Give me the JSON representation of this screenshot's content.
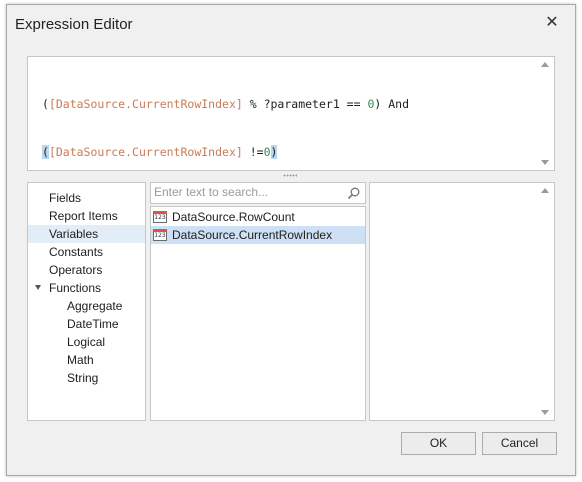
{
  "window": {
    "title": "Expression Editor",
    "close_glyph": "✕"
  },
  "expression": {
    "line1": [
      {
        "t": "(",
        "c": "plain"
      },
      {
        "t": "[DataSource.CurrentRowIndex]",
        "c": "field"
      },
      {
        "t": " % ?parameter1 == ",
        "c": "plain"
      },
      {
        "t": "0",
        "c": "num"
      },
      {
        "t": ") And",
        "c": "plain"
      }
    ],
    "line2": [
      {
        "t": "(",
        "c": "paren-hl"
      },
      {
        "t": "[DataSource.CurrentRowIndex]",
        "c": "field"
      },
      {
        "t": " !=",
        "c": "plain"
      },
      {
        "t": "0",
        "c": "num"
      },
      {
        "t": ")",
        "c": "paren-hl"
      }
    ]
  },
  "categories": [
    {
      "label": "Fields",
      "indent": 0
    },
    {
      "label": "Report Items",
      "indent": 0
    },
    {
      "label": "Variables",
      "indent": 0,
      "selected": true
    },
    {
      "label": "Constants",
      "indent": 0
    },
    {
      "label": "Operators",
      "indent": 0
    },
    {
      "label": "Functions",
      "indent": 0,
      "expanded": true
    },
    {
      "label": "Aggregate",
      "indent": 1
    },
    {
      "label": "DateTime",
      "indent": 1
    },
    {
      "label": "Logical",
      "indent": 1
    },
    {
      "label": "Math",
      "indent": 1
    },
    {
      "label": "String",
      "indent": 1
    }
  ],
  "search": {
    "placeholder": "Enter text to search..."
  },
  "items": [
    {
      "label": "DataSource.RowCount",
      "icon": "123",
      "selected": false
    },
    {
      "label": "DataSource.CurrentRowIndex",
      "icon": "123",
      "selected": true
    }
  ],
  "buttons": {
    "ok": "OK",
    "cancel": "Cancel"
  },
  "colors": {
    "field": "#cc7a55",
    "number": "#2e8b57",
    "selection": "#cde0f5"
  }
}
